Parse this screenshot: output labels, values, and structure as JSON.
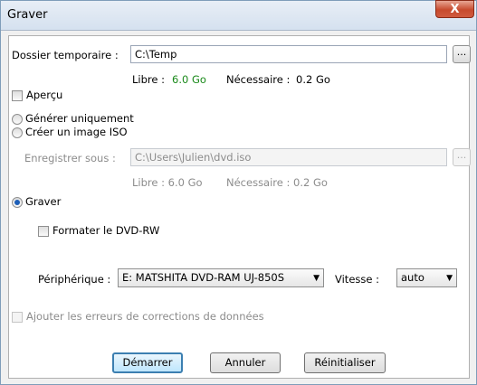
{
  "window": {
    "title": "Graver",
    "close_label": "X"
  },
  "temp_folder": {
    "label": "Dossier temporaire :",
    "value": "C:\\Temp",
    "browse_label": "...",
    "free_label": "Libre :",
    "free_value": "6.0 Go",
    "needed_label": "Nécessaire :",
    "needed_value": "0.2 Go"
  },
  "preview": {
    "label": "Aperçu"
  },
  "mode": {
    "generate_only": "Générer uniquement",
    "create_iso": "Créer un image ISO"
  },
  "save_as": {
    "label": "Enregistrer sous :",
    "value": "C:\\Users\\Julien\\dvd.iso",
    "browse_label": "...",
    "free_text": "Libre : 6.0 Go",
    "needed_text": "Nécessaire : 0.2 Go"
  },
  "burn": {
    "label": "Graver",
    "format_label": "Formater le DVD-RW"
  },
  "device": {
    "label": "Périphérique :",
    "value": "E: MATSHITA DVD-RAM UJ-850S"
  },
  "speed": {
    "label": "Vitesse :",
    "value": "auto"
  },
  "error_correction": {
    "label": "Ajouter les erreurs de corrections de données"
  },
  "buttons": {
    "start": "Démarrer",
    "cancel": "Annuler",
    "reset": "Réinitialiser"
  },
  "colors": {
    "free_value": "#1b8a1b",
    "selected_radio": "#1d5fb8"
  }
}
